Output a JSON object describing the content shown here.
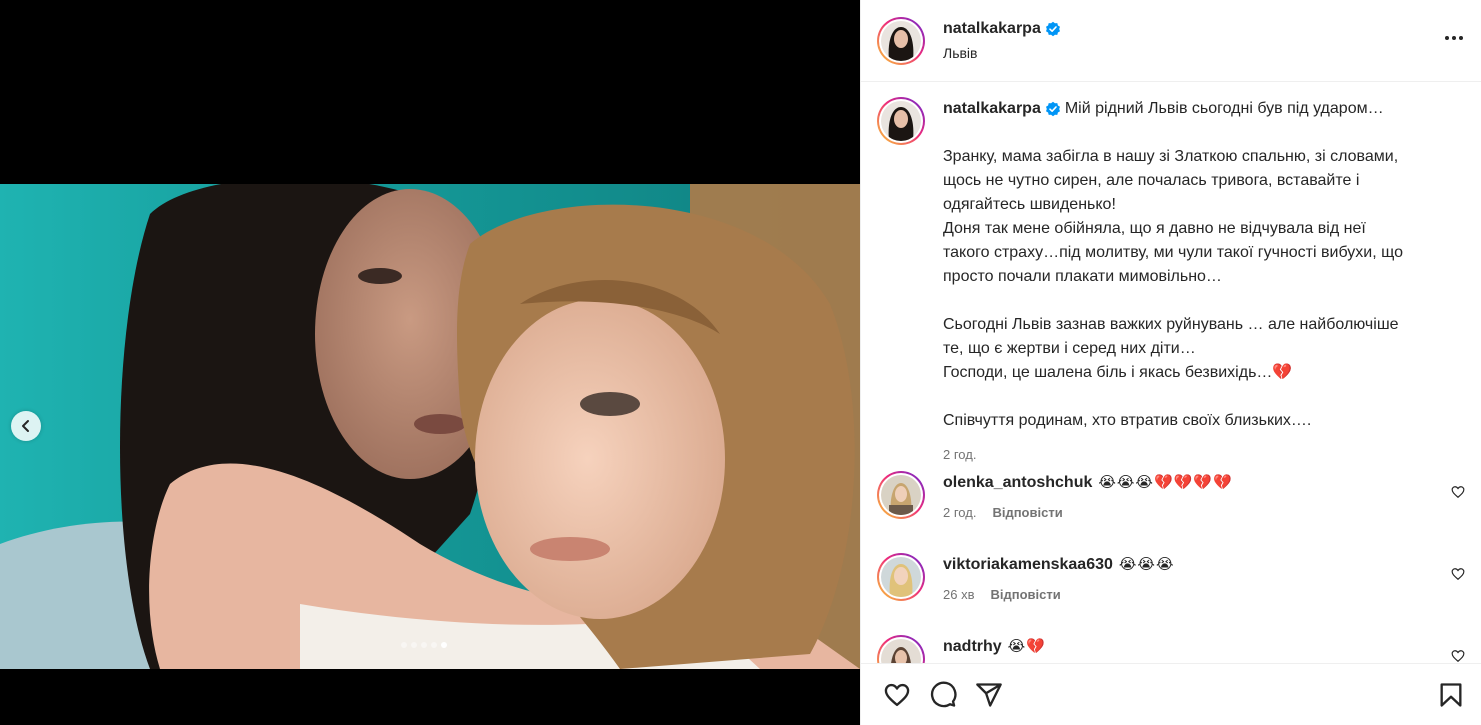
{
  "post": {
    "author": "natalkakarpa",
    "location": "Львів",
    "verified": true,
    "carousel": {
      "total": 5,
      "active_index": 4
    }
  },
  "caption": {
    "username": "natalkakarpa",
    "first_line": "Мій рідний Львів сьогодні був під ударом…",
    "paragraph1": [
      "Зранку, мама забігла в нашу зі Златкою спальню, зі словами,",
      "щось не чутно сирен, але почалась тривога, вставайте і",
      "одягайтесь швиденько!",
      "Доня так мене обійняла, що я давно не відчувала від неї",
      "такого страху…під молитву, ми чули такої гучності вибухи, що",
      "просто почали плакати мимовільно…"
    ],
    "paragraph2": [
      "Сьогодні Львів зазнав важких руйнувань … але найболючіше",
      "те, що є жертви і серед них діти…",
      "Господи, це шалена біль і якась безвихідь…"
    ],
    "paragraph2_emoji": "💔",
    "paragraph3": "Співчуття родинам, хто втратив своїх близьких….",
    "time": "2 год."
  },
  "comments": [
    {
      "username": "olenka_antoshchuk",
      "emojis": "😭😭😭💔💔💔💔",
      "time": "2 год.",
      "reply": "Відповісти"
    },
    {
      "username": "viktoriakamenskaa630",
      "emojis": "😭😭😭",
      "time": "26 хв",
      "reply": "Відповісти"
    },
    {
      "username": "nadtrhy",
      "emojis": "😭💔",
      "time": "",
      "reply": ""
    }
  ],
  "icons": {
    "like": "heart-icon",
    "comment": "comment-icon",
    "share": "share-icon",
    "save": "bookmark-icon",
    "more": "more-options-icon",
    "verified": "verified-badge-icon",
    "prev": "chevron-left-icon"
  },
  "colors": {
    "verified_blue": "#0095f6",
    "text": "#262626",
    "secondary_text": "#737373",
    "divider": "#efefef",
    "photo_background": "#1aa5a3"
  }
}
